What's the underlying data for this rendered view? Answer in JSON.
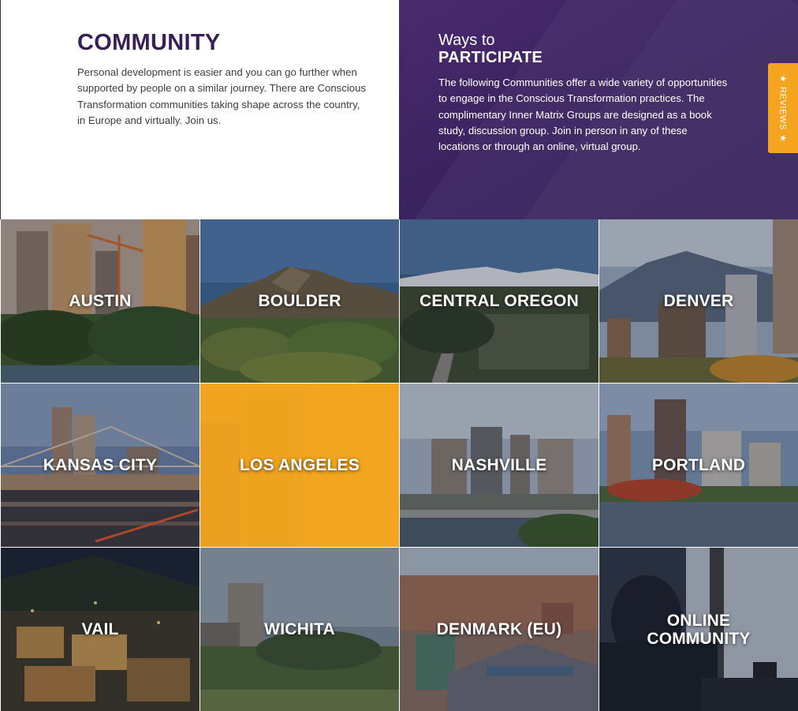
{
  "intro": {
    "title": "COMMUNITY",
    "body": "Personal development is easier and you can go further when supported by people on a similar journey. There are Conscious Transformation communities taking shape across the country, in Europe and virtually. Join us."
  },
  "ways": {
    "subtitle": "Ways to",
    "title": "PARTICIPATE",
    "body": "The following Communities offer a wide variety of opportunities to engage in the Conscious Transformation practices. The complimentary Inner Matrix Groups are designed as a book study, discussion group. Join in person in any of these locations or through an online, virtual group."
  },
  "reviews_tab": {
    "label": "REVIEWS",
    "icon": "star-icon"
  },
  "colors": {
    "purple": "#3a1f56",
    "orange": "#f4a41f"
  },
  "tiles": [
    {
      "label": "AUSTIN",
      "active": false
    },
    {
      "label": "BOULDER",
      "active": false
    },
    {
      "label": "CENTRAL OREGON",
      "active": false
    },
    {
      "label": "DENVER",
      "active": false
    },
    {
      "label": "KANSAS CITY",
      "active": false
    },
    {
      "label": "LOS ANGELES",
      "active": true
    },
    {
      "label": "NASHVILLE",
      "active": false
    },
    {
      "label": "PORTLAND",
      "active": false
    },
    {
      "label": "VAIL",
      "active": false
    },
    {
      "label": "WICHITA",
      "active": false
    },
    {
      "label": "DENMARK (EU)",
      "active": false
    },
    {
      "label": "ONLINE COMMUNITY",
      "active": false
    }
  ]
}
